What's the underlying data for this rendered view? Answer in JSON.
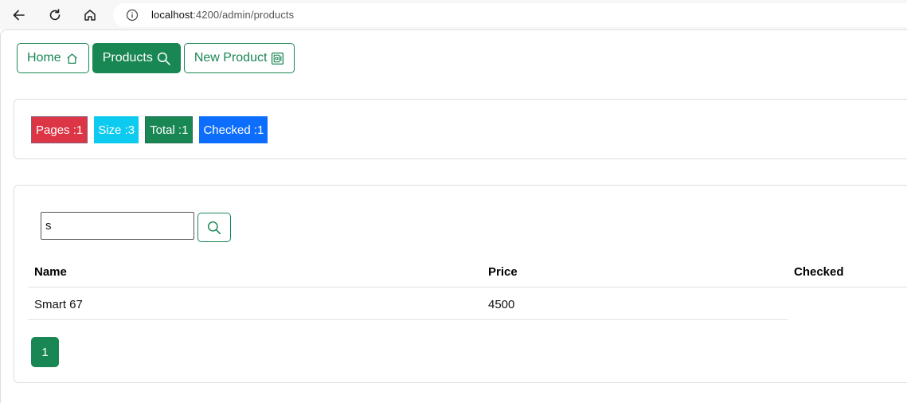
{
  "browser": {
    "url_host": "localhost",
    "url_path": ":4200/admin/products"
  },
  "nav": {
    "home_label": "Home",
    "products_label": "Products",
    "new_product_label": "New Product"
  },
  "stats": [
    {
      "label": "Pages :1",
      "color": "#dc3545"
    },
    {
      "label": "Size :3",
      "color": "#0dcaf0"
    },
    {
      "label": "Total :1",
      "color": "#198754"
    },
    {
      "label": "Checked :1",
      "color": "#0d6efd"
    }
  ],
  "search": {
    "value": "s"
  },
  "table": {
    "columns": [
      "Name",
      "Price",
      "Checked"
    ],
    "rows": [
      {
        "name": "Smart 67",
        "price": "4500",
        "checked": ""
      }
    ]
  },
  "pagination": {
    "pages": [
      "1"
    ]
  },
  "colors": {
    "accent": "#198754"
  }
}
